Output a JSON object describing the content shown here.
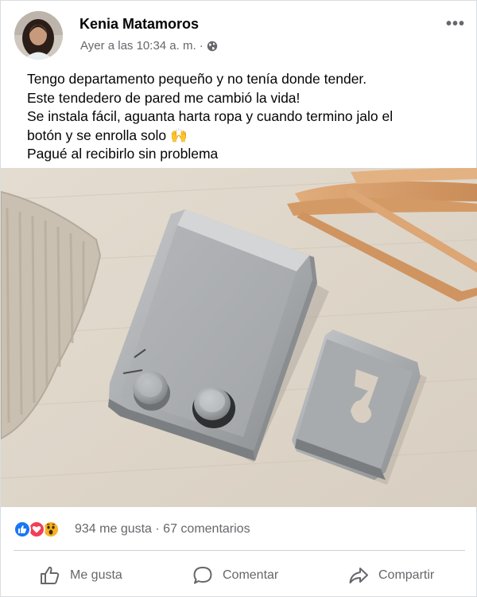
{
  "post": {
    "author": "Kenia Matamoros",
    "timestamp": "Ayer a las 10:34 a. m. ·",
    "privacy_icon": "globe-icon",
    "more_label": "•••",
    "text_lines": [
      "Tengo departamento pequeño y no tenía donde tender.",
      "Este tendedero de pared me cambió la vida!",
      "Se instala fácil, aguanta harta ropa y cuando termino jalo el",
      "botón y se enrolla solo 🙌",
      "Pagué al recibirlo sin problema"
    ]
  },
  "reactions": {
    "icons": [
      "like-icon",
      "love-icon",
      "wow-icon"
    ],
    "summary": "934 me gusta · 67 comentarios"
  },
  "actions": {
    "like_label": "Me gusta",
    "comment_label": "Comentar",
    "share_label": "Compartir"
  },
  "colors": {
    "like_blue": "#1877f2",
    "love_red": "#f33e58",
    "wow_yellow": "#f7b125",
    "secondary_text": "#65676b"
  }
}
